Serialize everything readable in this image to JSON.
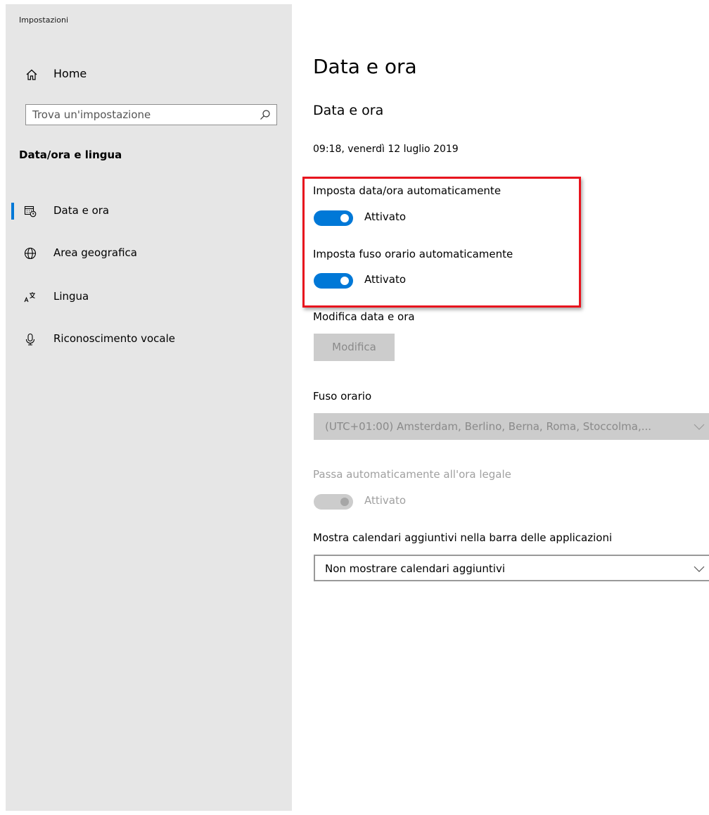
{
  "app": {
    "title": "Impostazioni"
  },
  "sidebar": {
    "home_label": "Home",
    "search": {
      "placeholder": "Trova un'impostazione"
    },
    "section_title": "Data/ora e lingua",
    "items": [
      {
        "label": "Data e ora",
        "icon": "calendar-clock-icon",
        "active": true
      },
      {
        "label": "Area geografica",
        "icon": "globe-icon",
        "active": false
      },
      {
        "label": "Lingua",
        "icon": "language-icon",
        "active": false
      },
      {
        "label": "Riconoscimento vocale",
        "icon": "microphone-icon",
        "active": false
      }
    ]
  },
  "main": {
    "page_title": "Data e ora",
    "section_title": "Data e ora",
    "current_datetime": "09:18, venerdì 12 luglio 2019",
    "auto_time": {
      "label": "Imposta data/ora automaticamente",
      "state": "Attivato",
      "on": true
    },
    "auto_timezone": {
      "label": "Imposta fuso orario automaticamente",
      "state": "Attivato",
      "on": true
    },
    "change_datetime": {
      "label": "Modifica data e ora",
      "button": "Modifica"
    },
    "timezone": {
      "label": "Fuso orario",
      "value": "(UTC+01:00) Amsterdam, Berlino, Berna, Roma, Stoccolma,..."
    },
    "dst": {
      "label": "Passa automaticamente all'ora legale",
      "state": "Attivato",
      "on": true,
      "disabled": true
    },
    "calendars": {
      "label": "Mostra calendari aggiuntivi nella barra delle applicazioni",
      "value": "Non mostrare calendari aggiuntivi"
    }
  },
  "colors": {
    "accent": "#0078d7",
    "highlight": "#e8141e",
    "sidebar_bg": "#e6e6e6"
  }
}
